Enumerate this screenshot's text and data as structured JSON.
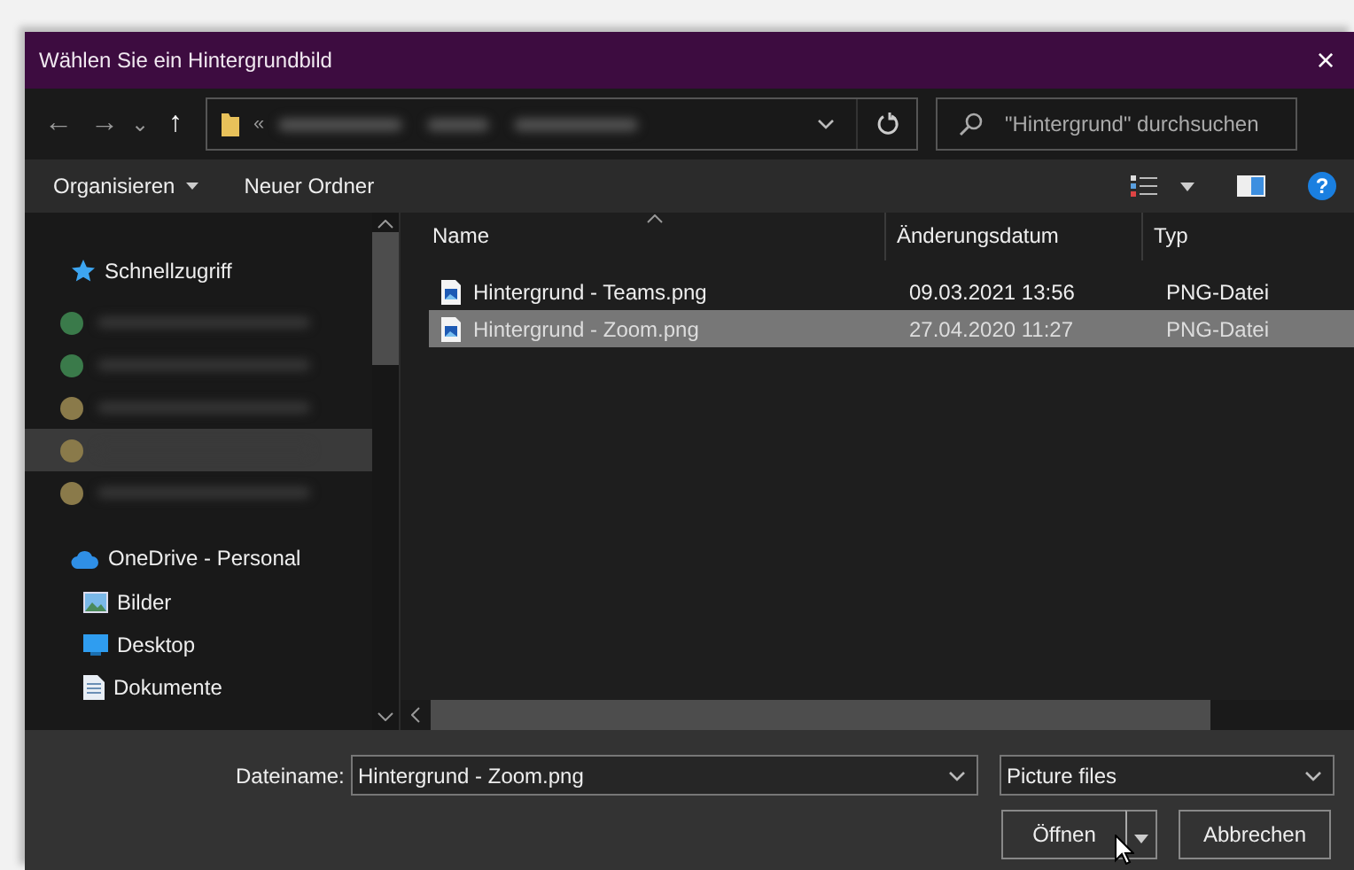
{
  "window": {
    "title": "Wählen Sie ein Hintergrundbild",
    "close": "×"
  },
  "nav": {
    "back": "←",
    "forward": "→",
    "recent": "⌄",
    "up": "↑",
    "path_collapsed": "«",
    "search": {
      "placeholder": "\"Hintergrund\" durchsuchen"
    }
  },
  "toolbar": {
    "items": [
      "Organisieren",
      "Neuer Ordner"
    ],
    "help": "?"
  },
  "sidebar": {
    "items": [
      {
        "kind": "star",
        "label": "Schnellzugriff",
        "selected": false
      },
      {
        "kind": "blurred",
        "color": "#3a7a4a",
        "selected": false
      },
      {
        "kind": "blurred",
        "color": "#3a7a4a",
        "selected": false
      },
      {
        "kind": "blurred",
        "color": "#8a7a4a",
        "selected": false
      },
      {
        "kind": "blurred",
        "color": "#8a7a4a",
        "selected": true
      },
      {
        "kind": "blurred",
        "color": "#8a7a4a",
        "selected": false
      },
      {
        "kind": "cloud",
        "label": "OneDrive - Personal",
        "selected": false
      },
      {
        "kind": "pictures",
        "label": "Bilder",
        "selected": false
      },
      {
        "kind": "desktop",
        "label": "Desktop",
        "selected": false
      },
      {
        "kind": "documents",
        "label": "Dokumente",
        "selected": false
      }
    ]
  },
  "table": {
    "columns": [
      "Name",
      "Änderungsdatum",
      "Typ"
    ],
    "rows": [
      {
        "name": "Hintergrund - Teams.png",
        "date": "09.03.2021 13:56",
        "type": "PNG-Datei",
        "selected": false
      },
      {
        "name": "Hintergrund - Zoom.png",
        "date": "27.04.2020 11:27",
        "type": "PNG-Datei",
        "selected": true
      }
    ]
  },
  "footer": {
    "filename_label": "Dateiname:",
    "filename": "Hintergrund - Zoom.png",
    "filter": "Picture files",
    "buttons": [
      "Öffnen",
      "Abbrechen"
    ]
  }
}
